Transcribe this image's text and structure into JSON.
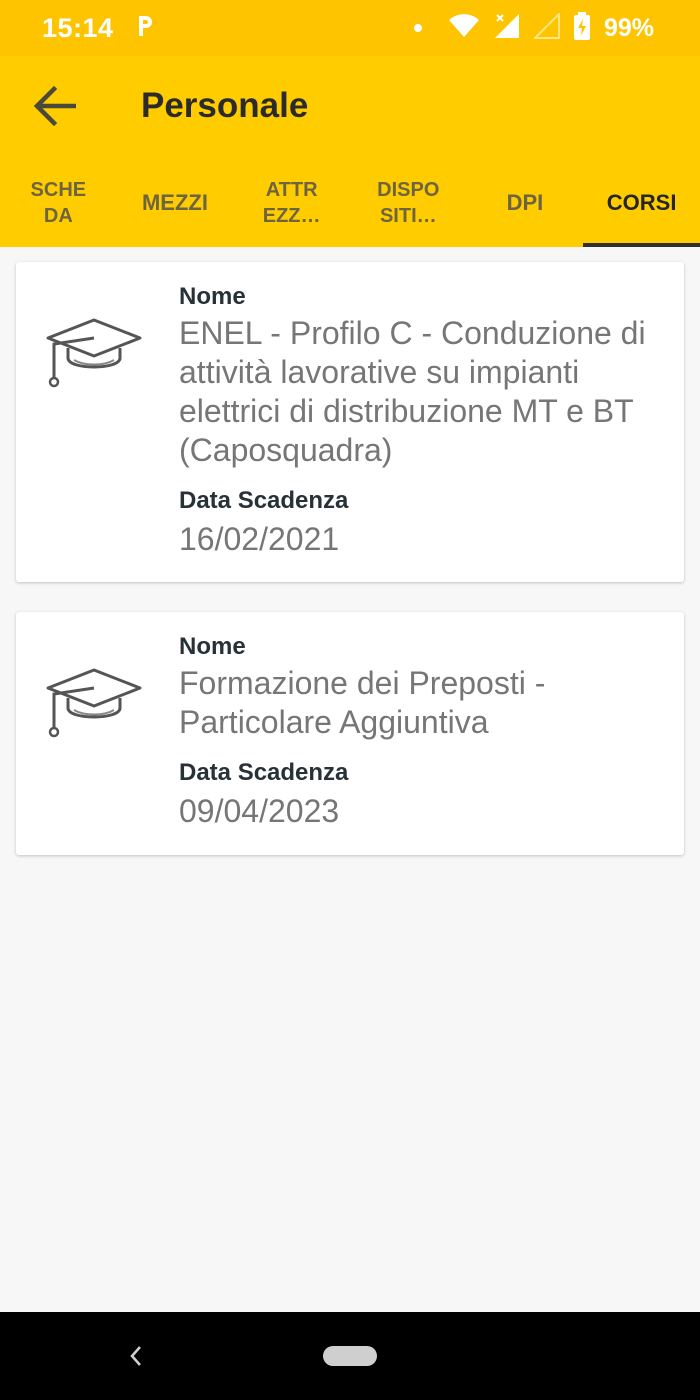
{
  "status_bar": {
    "time": "15:14",
    "battery": "99%",
    "icons": [
      "parking-icon",
      "dot-icon",
      "wifi-icon",
      "signal-icon",
      "no-signal-icon",
      "battery-charging-icon"
    ]
  },
  "app_bar": {
    "title": "Personale",
    "back_icon": "arrow-left-icon",
    "background": "#ffcc00"
  },
  "tabs": [
    {
      "label": "SCHE\nDA",
      "active": false
    },
    {
      "label": "MEZZI",
      "active": false
    },
    {
      "label": "ATTR\nEZZ…",
      "active": false
    },
    {
      "label": "DISPO\nSITI…",
      "active": false
    },
    {
      "label": "DPI",
      "active": false
    },
    {
      "label": "CORSI",
      "active": true
    }
  ],
  "courses": [
    {
      "icon": "graduation-cap-icon",
      "name_label": "Nome",
      "name": "ENEL - Profilo C - Conduzione di attività lavorative su impianti elettrici di distribuzione MT e BT (Caposquadra)",
      "expiry_label": "Data Scadenza",
      "expiry": "16/02/2021"
    },
    {
      "icon": "graduation-cap-icon",
      "name_label": "Nome",
      "name": "Formazione dei Preposti - Particolare Aggiuntiva",
      "expiry_label": "Data Scadenza",
      "expiry": "09/04/2023"
    }
  ],
  "nav_bar": {
    "back_icon": "nav-back-icon",
    "home_icon": "home-pill-icon"
  }
}
